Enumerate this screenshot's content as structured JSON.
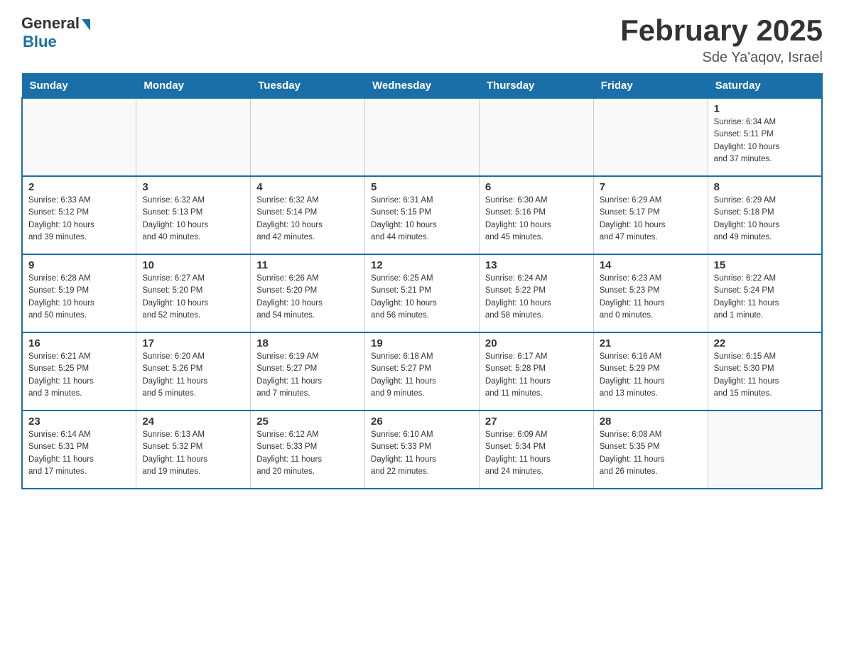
{
  "header": {
    "logo_general": "General",
    "logo_blue": "Blue",
    "month_title": "February 2025",
    "location": "Sde Ya'aqov, Israel"
  },
  "weekdays": [
    "Sunday",
    "Monday",
    "Tuesday",
    "Wednesday",
    "Thursday",
    "Friday",
    "Saturday"
  ],
  "weeks": [
    [
      {
        "day": "",
        "info": ""
      },
      {
        "day": "",
        "info": ""
      },
      {
        "day": "",
        "info": ""
      },
      {
        "day": "",
        "info": ""
      },
      {
        "day": "",
        "info": ""
      },
      {
        "day": "",
        "info": ""
      },
      {
        "day": "1",
        "info": "Sunrise: 6:34 AM\nSunset: 5:11 PM\nDaylight: 10 hours\nand 37 minutes."
      }
    ],
    [
      {
        "day": "2",
        "info": "Sunrise: 6:33 AM\nSunset: 5:12 PM\nDaylight: 10 hours\nand 39 minutes."
      },
      {
        "day": "3",
        "info": "Sunrise: 6:32 AM\nSunset: 5:13 PM\nDaylight: 10 hours\nand 40 minutes."
      },
      {
        "day": "4",
        "info": "Sunrise: 6:32 AM\nSunset: 5:14 PM\nDaylight: 10 hours\nand 42 minutes."
      },
      {
        "day": "5",
        "info": "Sunrise: 6:31 AM\nSunset: 5:15 PM\nDaylight: 10 hours\nand 44 minutes."
      },
      {
        "day": "6",
        "info": "Sunrise: 6:30 AM\nSunset: 5:16 PM\nDaylight: 10 hours\nand 45 minutes."
      },
      {
        "day": "7",
        "info": "Sunrise: 6:29 AM\nSunset: 5:17 PM\nDaylight: 10 hours\nand 47 minutes."
      },
      {
        "day": "8",
        "info": "Sunrise: 6:29 AM\nSunset: 5:18 PM\nDaylight: 10 hours\nand 49 minutes."
      }
    ],
    [
      {
        "day": "9",
        "info": "Sunrise: 6:28 AM\nSunset: 5:19 PM\nDaylight: 10 hours\nand 50 minutes."
      },
      {
        "day": "10",
        "info": "Sunrise: 6:27 AM\nSunset: 5:20 PM\nDaylight: 10 hours\nand 52 minutes."
      },
      {
        "day": "11",
        "info": "Sunrise: 6:26 AM\nSunset: 5:20 PM\nDaylight: 10 hours\nand 54 minutes."
      },
      {
        "day": "12",
        "info": "Sunrise: 6:25 AM\nSunset: 5:21 PM\nDaylight: 10 hours\nand 56 minutes."
      },
      {
        "day": "13",
        "info": "Sunrise: 6:24 AM\nSunset: 5:22 PM\nDaylight: 10 hours\nand 58 minutes."
      },
      {
        "day": "14",
        "info": "Sunrise: 6:23 AM\nSunset: 5:23 PM\nDaylight: 11 hours\nand 0 minutes."
      },
      {
        "day": "15",
        "info": "Sunrise: 6:22 AM\nSunset: 5:24 PM\nDaylight: 11 hours\nand 1 minute."
      }
    ],
    [
      {
        "day": "16",
        "info": "Sunrise: 6:21 AM\nSunset: 5:25 PM\nDaylight: 11 hours\nand 3 minutes."
      },
      {
        "day": "17",
        "info": "Sunrise: 6:20 AM\nSunset: 5:26 PM\nDaylight: 11 hours\nand 5 minutes."
      },
      {
        "day": "18",
        "info": "Sunrise: 6:19 AM\nSunset: 5:27 PM\nDaylight: 11 hours\nand 7 minutes."
      },
      {
        "day": "19",
        "info": "Sunrise: 6:18 AM\nSunset: 5:27 PM\nDaylight: 11 hours\nand 9 minutes."
      },
      {
        "day": "20",
        "info": "Sunrise: 6:17 AM\nSunset: 5:28 PM\nDaylight: 11 hours\nand 11 minutes."
      },
      {
        "day": "21",
        "info": "Sunrise: 6:16 AM\nSunset: 5:29 PM\nDaylight: 11 hours\nand 13 minutes."
      },
      {
        "day": "22",
        "info": "Sunrise: 6:15 AM\nSunset: 5:30 PM\nDaylight: 11 hours\nand 15 minutes."
      }
    ],
    [
      {
        "day": "23",
        "info": "Sunrise: 6:14 AM\nSunset: 5:31 PM\nDaylight: 11 hours\nand 17 minutes."
      },
      {
        "day": "24",
        "info": "Sunrise: 6:13 AM\nSunset: 5:32 PM\nDaylight: 11 hours\nand 19 minutes."
      },
      {
        "day": "25",
        "info": "Sunrise: 6:12 AM\nSunset: 5:33 PM\nDaylight: 11 hours\nand 20 minutes."
      },
      {
        "day": "26",
        "info": "Sunrise: 6:10 AM\nSunset: 5:33 PM\nDaylight: 11 hours\nand 22 minutes."
      },
      {
        "day": "27",
        "info": "Sunrise: 6:09 AM\nSunset: 5:34 PM\nDaylight: 11 hours\nand 24 minutes."
      },
      {
        "day": "28",
        "info": "Sunrise: 6:08 AM\nSunset: 5:35 PM\nDaylight: 11 hours\nand 26 minutes."
      },
      {
        "day": "",
        "info": ""
      }
    ]
  ]
}
